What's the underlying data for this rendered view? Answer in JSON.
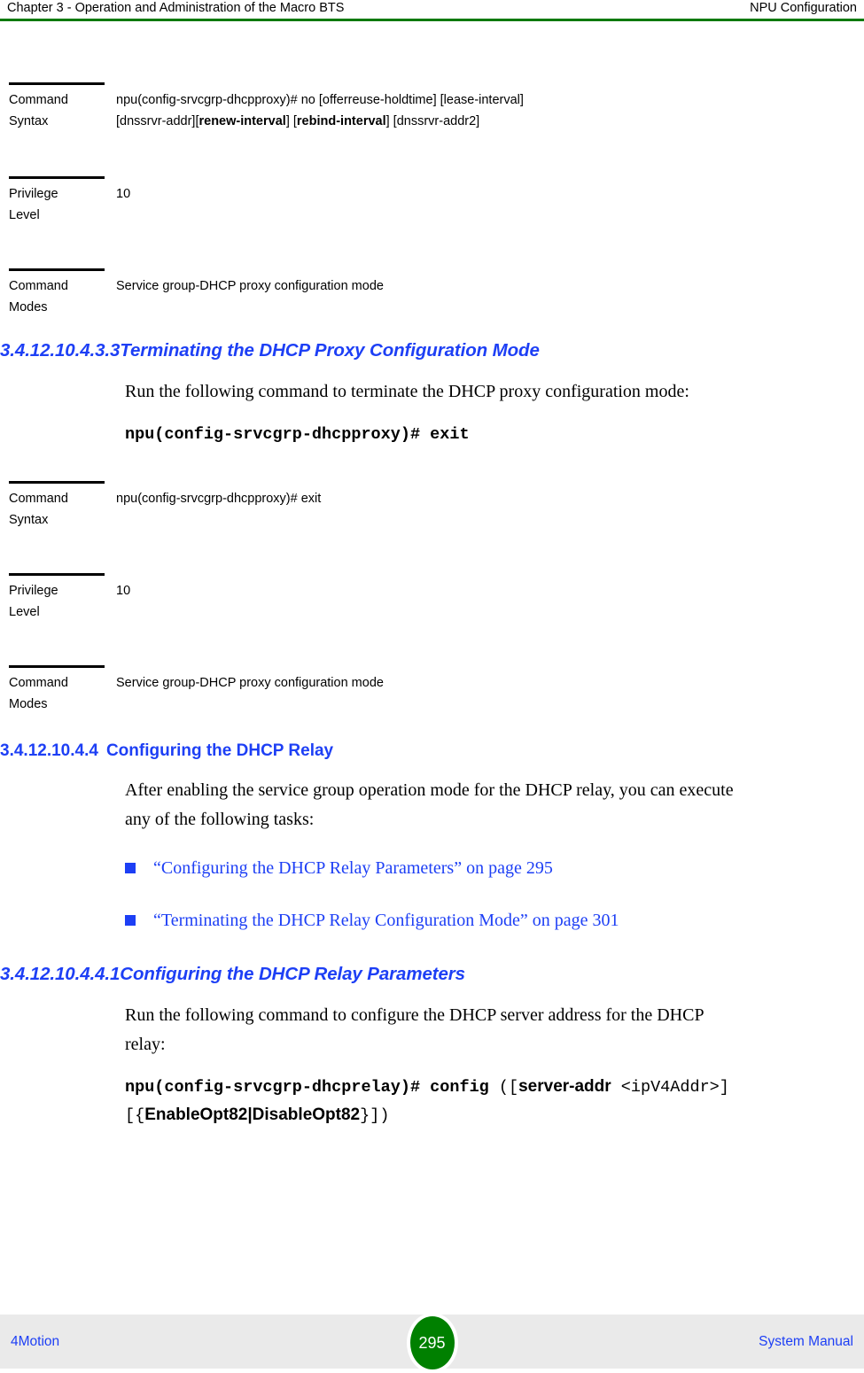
{
  "header": {
    "left": "Chapter 3 - Operation and Administration of the Macro BTS",
    "right": "NPU Configuration",
    "rule_color": "#0a7a0a"
  },
  "colors": {
    "heading_blue": "#1d3ff5",
    "link_blue": "#1d3ff5",
    "bullet_blue": "#1d3ff5",
    "badge_green": "#008000",
    "footer_bg": "#eaeaea",
    "rule_black": "#000000"
  },
  "table_1": {
    "rows": [
      {
        "label_line1": "Command",
        "label_line2": "Syntax",
        "value_line1_a": "npu(config-srvcgrp-dhcpproxy)# no [offerreuse-holdtime] [lease-interval]",
        "value_line2_a": "[dnssrvr-addr][",
        "value_line2_b": "renew-interval",
        "value_line2_c": "] [",
        "value_line2_d": "rebind-interval",
        "value_line2_e": "] [dnssrvr-addr2]"
      },
      {
        "label_line1": "Privilege",
        "label_line2": "Level",
        "value": "10"
      },
      {
        "label_line1": "Command",
        "label_line2": "Modes",
        "value": "Service group-DHCP proxy configuration mode"
      }
    ]
  },
  "section_terminate_proxy": {
    "heading_number": "3.4.12.10.4.3.3",
    "heading_title": "Terminating the DHCP Proxy Configuration Mode",
    "paragraph": "Run the following command to terminate the DHCP proxy configuration mode:",
    "code": "npu(config-srvcgrp-dhcpproxy)# exit"
  },
  "table_2": {
    "rows": [
      {
        "label_line1": "Command",
        "label_line2": "Syntax",
        "value": "npu(config-srvcgrp-dhcpproxy)# exit"
      },
      {
        "label_line1": "Privilege",
        "label_line2": "Level",
        "value": "10"
      },
      {
        "label_line1": "Command",
        "label_line2": "Modes",
        "value": "Service group-DHCP proxy configuration mode"
      }
    ]
  },
  "section_dhcp_relay": {
    "heading_number": "3.4.12.10.4.4",
    "heading_title": "Configuring the DHCP Relay",
    "paragraph": "After enabling the service group operation mode for the DHCP relay, you can execute any of the following tasks:",
    "links": [
      "“Configuring the DHCP Relay Parameters” on page 295",
      "“Terminating the DHCP Relay Configuration Mode” on page 301"
    ]
  },
  "section_relay_params": {
    "heading_number": "3.4.12.10.4.4.1",
    "heading_title": "Configuring the DHCP Relay Parameters",
    "paragraph": "Run the following command to configure the DHCP server address for the DHCP relay:",
    "code_line1_a": "npu(config-srvcgrp-dhcprelay)# config ",
    "code_line1_b": "([",
    "code_line1_c": "server-addr",
    "code_line1_d": " <ipV4Addr>]",
    "code_line2_a": "[{",
    "code_line2_b": "EnableOpt82|DisableOpt82",
    "code_line2_c": "}])"
  },
  "footer": {
    "left": "4Motion",
    "page_number": "295",
    "right": "System Manual"
  }
}
